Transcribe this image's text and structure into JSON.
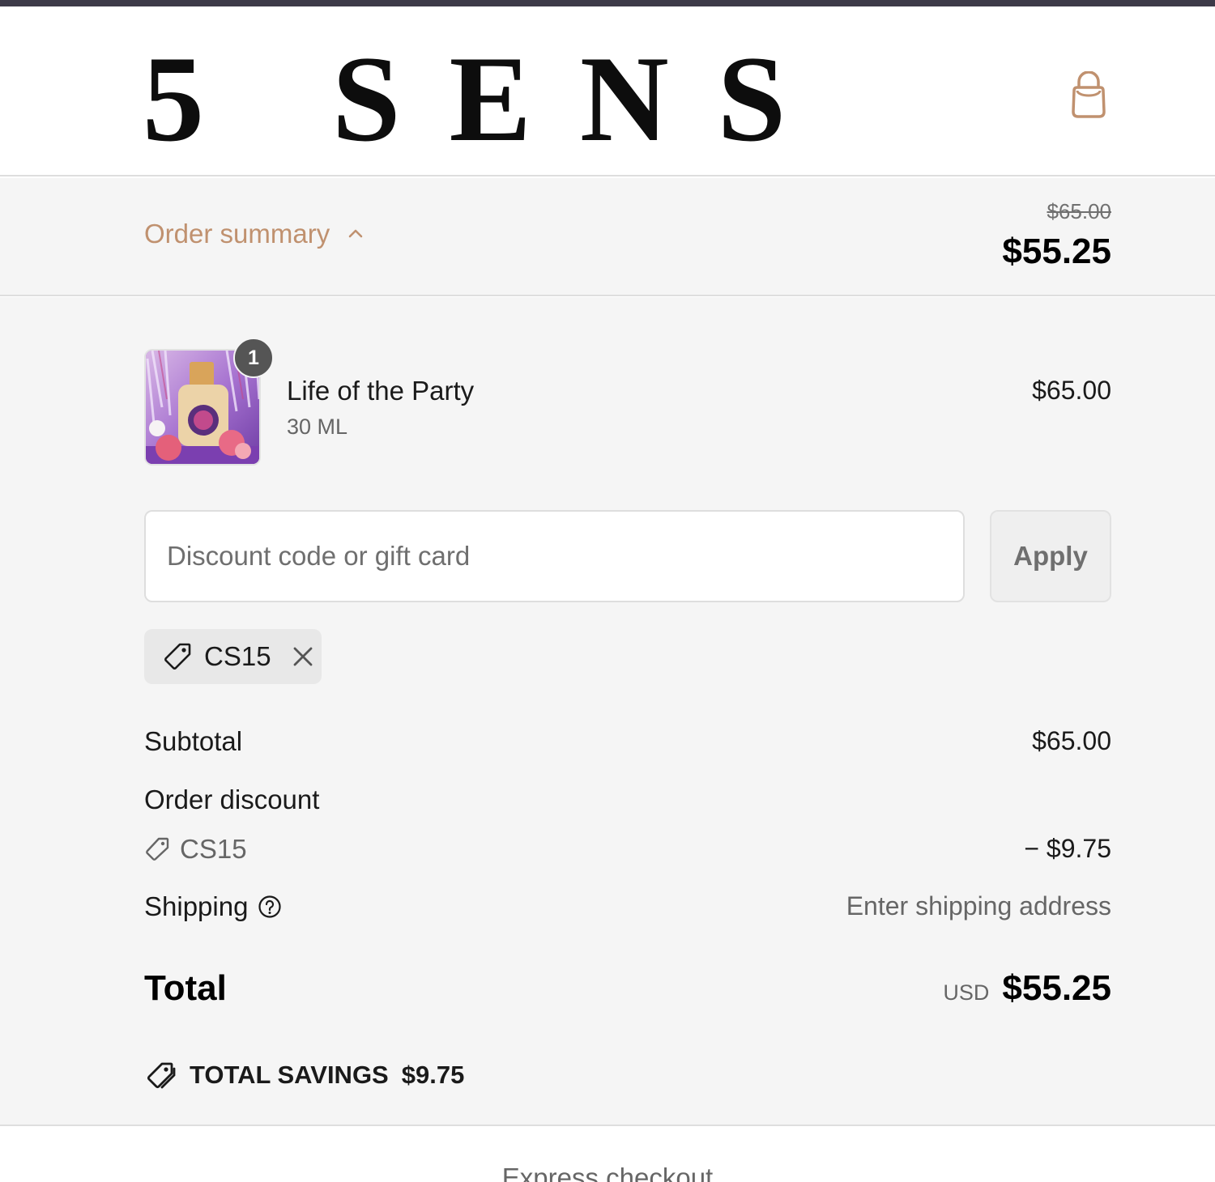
{
  "brand": {
    "logo_text": "5 SENS"
  },
  "header": {
    "cart_icon": "shopping-bag-icon",
    "accent_color": "#c0916f"
  },
  "order_summary": {
    "toggle_label": "Order summary",
    "toggle_icon": "chevron-up-icon",
    "original_price": "$65.00",
    "total": "$55.25"
  },
  "line_items": [
    {
      "name": "Life of the Party",
      "variant": "30 ML",
      "price": "$65.00",
      "quantity": "1"
    }
  ],
  "discount": {
    "placeholder": "Discount code or gift card",
    "value": "",
    "apply_label": "Apply",
    "applied_code": "CS15"
  },
  "totals": {
    "subtotal_label": "Subtotal",
    "subtotal_value": "$65.00",
    "order_discount_label": "Order discount",
    "discount_code": "CS15",
    "discount_value": "− $9.75",
    "shipping_label": "Shipping",
    "shipping_value": "Enter shipping address",
    "total_label": "Total",
    "currency": "USD",
    "total_value": "$55.25",
    "savings_label": "TOTAL SAVINGS",
    "savings_value": "$9.75"
  },
  "express": {
    "label": "Express checkout"
  }
}
